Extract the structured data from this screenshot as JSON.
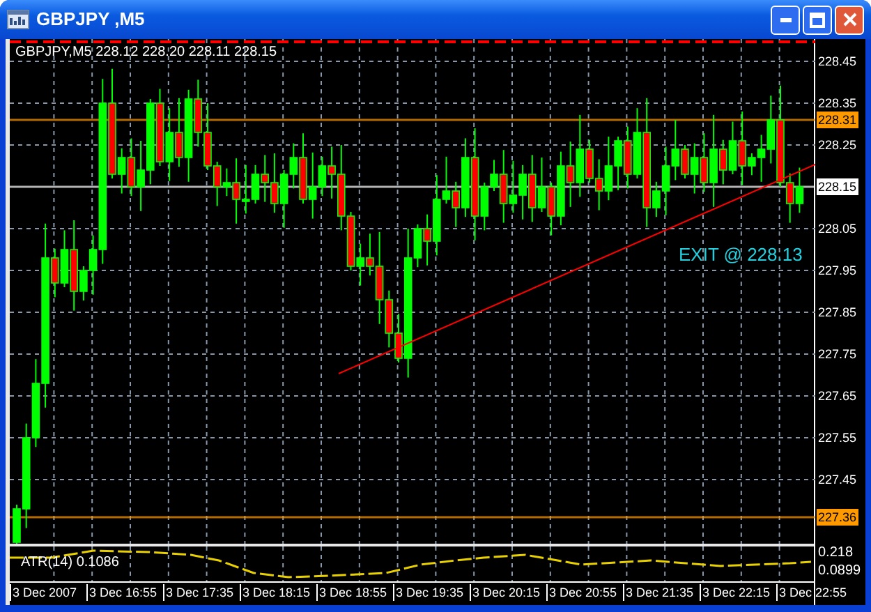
{
  "window": {
    "title": "GBPJPY ,M5"
  },
  "chart": {
    "symbol": "GBPJPY,M5",
    "ohlc": "228.12 228.20 228.11 228.15",
    "price_ticks": [
      "228.45",
      "228.35",
      "228.25",
      "228.05",
      "227.95",
      "227.85",
      "227.75",
      "227.65",
      "227.55",
      "227.45"
    ],
    "price_levels": [
      {
        "label": "228.31",
        "color": "#ff9900"
      },
      {
        "label": "228.15",
        "color": "#ffffff"
      },
      {
        "label": "227.36",
        "color": "#ff9900"
      }
    ],
    "annotation": "EXIT @ 228.13",
    "time_labels": [
      "3 Dec 2007",
      "3 Dec 16:55",
      "3 Dec 17:35",
      "3 Dec 18:15",
      "3 Dec 18:55",
      "3 Dec 19:35",
      "3 Dec 20:15",
      "3 Dec 20:55",
      "3 Dec 21:35",
      "3 Dec 22:15",
      "3 Dec 22:55"
    ]
  },
  "indicator": {
    "label": "ATR(14) 0.1086",
    "scale": [
      "0.218",
      "0.0899"
    ]
  }
}
